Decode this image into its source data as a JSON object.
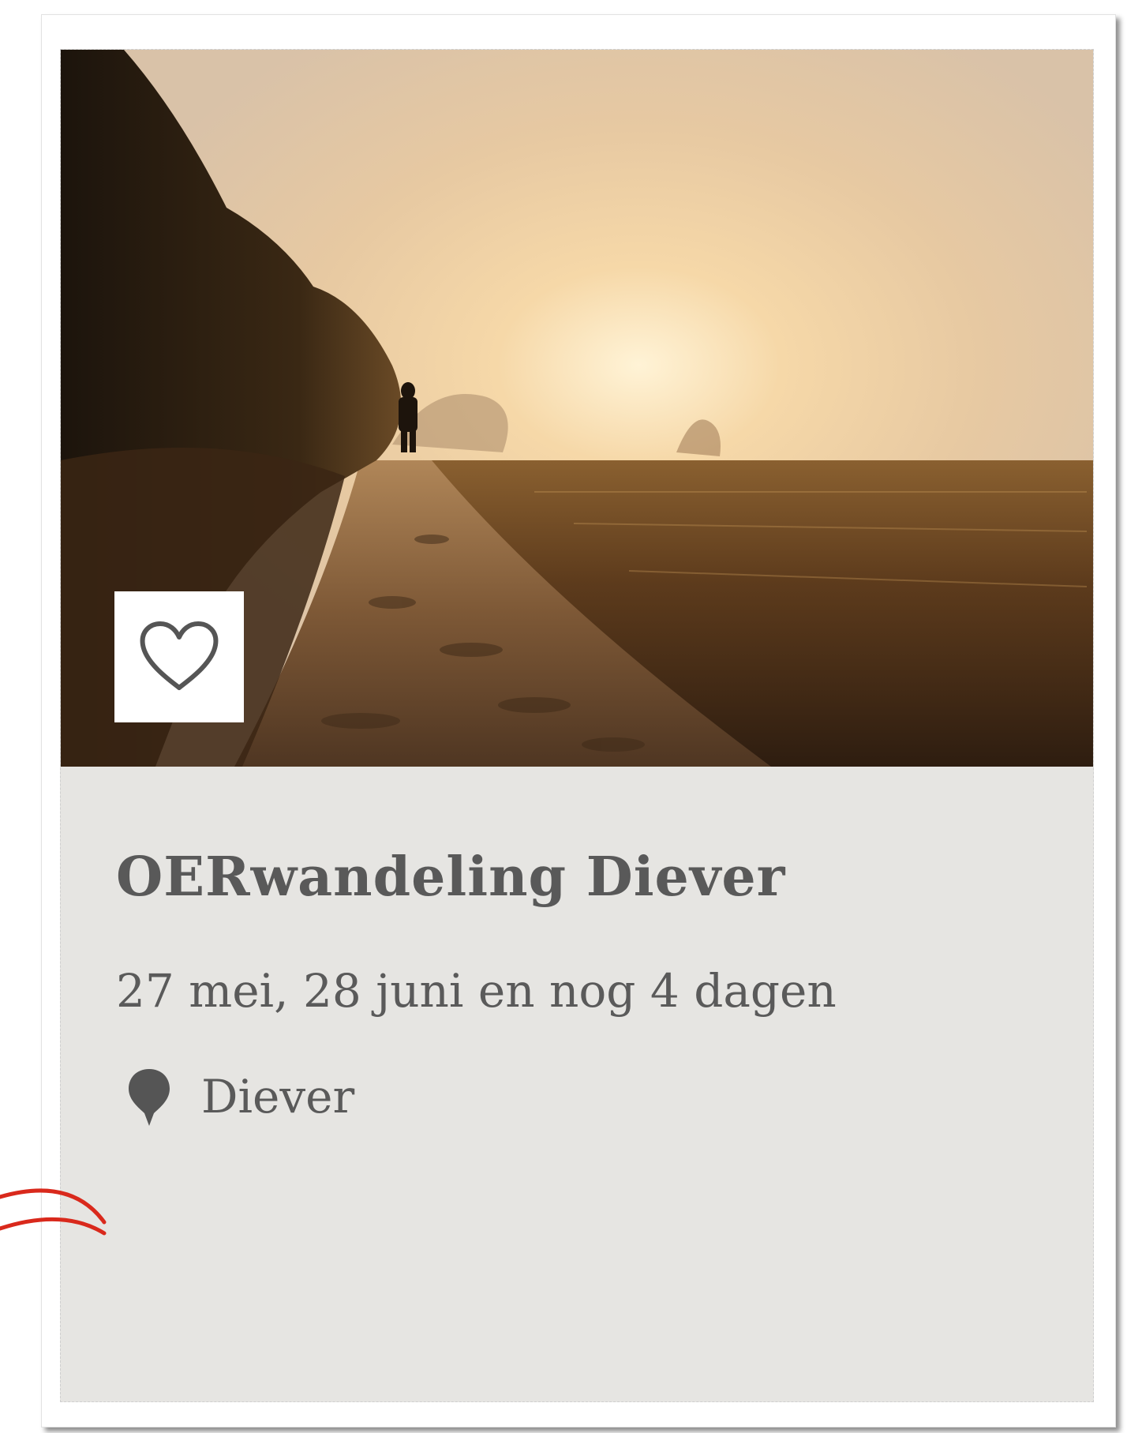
{
  "event_card": {
    "title": "OERwandeling Diever",
    "dates": "27 mei, 28 juni en nog 4 dagen",
    "location": "Diever",
    "favorite_icon": "heart-outline-icon",
    "location_icon": "map-pin-icon"
  },
  "colors": {
    "card_background": "#e6e5e2",
    "text": "#595959",
    "annotation": "#d9291c"
  }
}
